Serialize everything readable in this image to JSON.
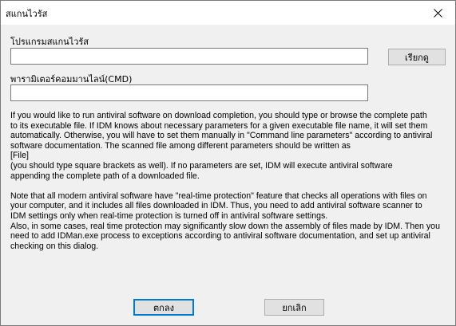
{
  "window": {
    "title": "สแกนไวรัส"
  },
  "program": {
    "label": "โปรแกรมสแกนไวรัส",
    "value": "",
    "browse_label": "เรียกดู"
  },
  "cmd": {
    "label": "พารามิเตอร์คอมมานไลน์(CMD)",
    "value": ""
  },
  "description": {
    "paragraph1": "If you would like to run antiviral software on download completion, you should type or browse the complete path\nto its executable file. If IDM knows about necessary parameters for a given executable file name, it will set them\nautomatically. Otherwise, you will have to set them manually in \"Command line parameters\" according to antiviral\nsoftware documentation. The scanned file among different parameters should be written as\n[File]\n(you should type square brackets as well). If no parameters are set, IDM will execute antiviral software\nappending the complete path of a downloaded file.",
    "paragraph2": "Note that all modern antiviral software have \"real-time protection\" feature that checks all operations with files on\nyour computer, and it includes all files downloaded in IDM. Thus, you need to add antiviral software scanner to\nIDM settings only when real-time protection is turned off in antiviral software settings.\nAlso, in some cases, real time protection may significantly slow down the assembly of files made by IDM. Then you\nneed to add IDMan.exe process to exceptions according to antiviral software documentation, and set up antiviral\nchecking on this dialog."
  },
  "buttons": {
    "ok_label": "ตกลง",
    "cancel_label": "ยกเลิก"
  }
}
